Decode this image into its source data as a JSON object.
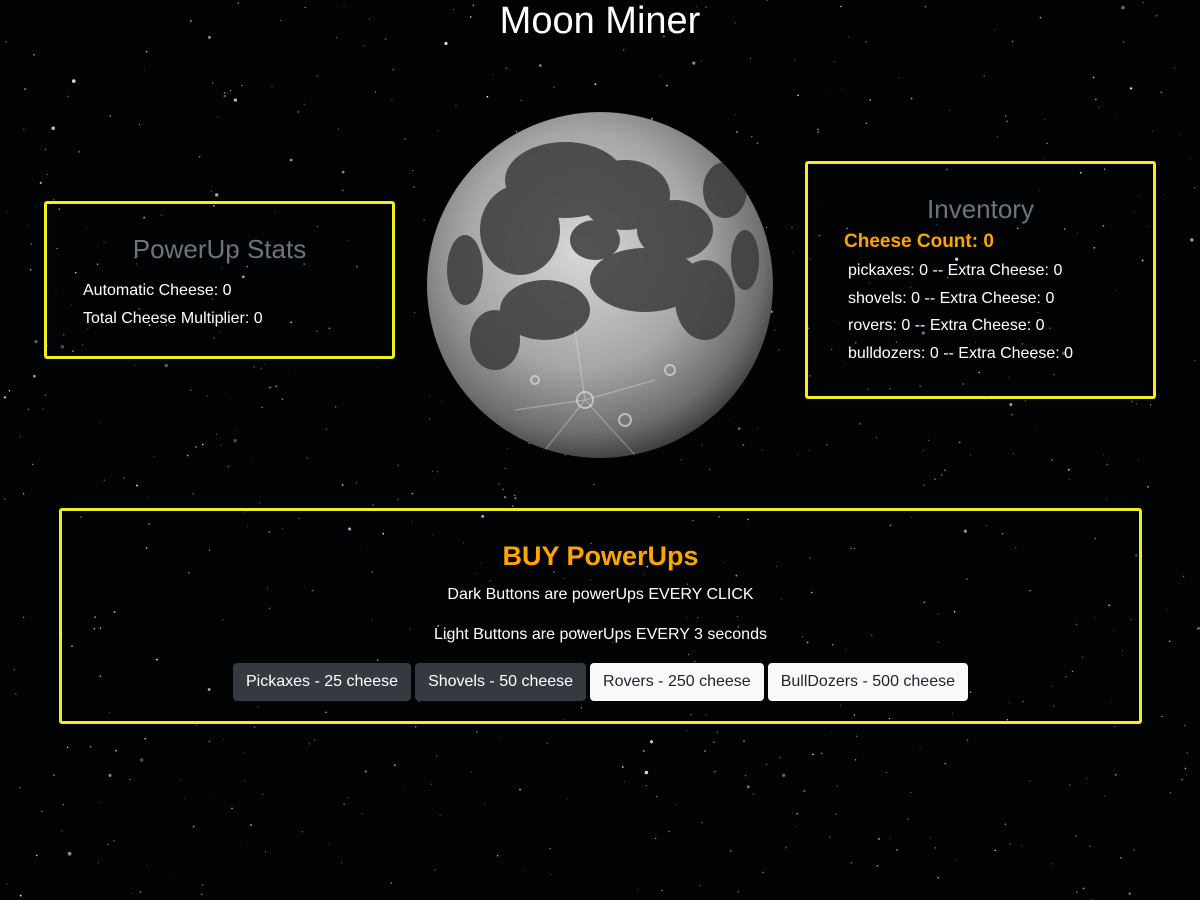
{
  "page": {
    "title": "Moon Miner"
  },
  "powerup_stats": {
    "heading": "PowerUp Stats",
    "automatic_cheese_label": "Automatic Cheese:",
    "automatic_cheese": "0",
    "total_multiplier_label": "Total Cheese Multiplier:",
    "total_multiplier": "0"
  },
  "inventory": {
    "heading": "Inventory",
    "cheese_count_label": "Cheese Count:",
    "cheese_count": "0",
    "extra_label": "-- Extra Cheese:",
    "items": [
      {
        "name": "pickaxes:",
        "count": "0",
        "extra": "0"
      },
      {
        "name": "shovels:",
        "count": "0",
        "extra": "0"
      },
      {
        "name": "rovers:",
        "count": "0",
        "extra": "0"
      },
      {
        "name": "bulldozers:",
        "count": "0",
        "extra": "0"
      }
    ]
  },
  "moon": {
    "icon": "moon-icon"
  },
  "buy": {
    "heading": "BUY PowerUps",
    "desc_dark": "Dark Buttons are powerUps EVERY CLICK",
    "desc_light": "Light Buttons are powerUps EVERY 3 seconds",
    "buttons": [
      {
        "label": "Pickaxes - 25 cheese",
        "style": "dark"
      },
      {
        "label": "Shovels - 50 cheese",
        "style": "dark"
      },
      {
        "label": "Rovers - 250 cheese",
        "style": "light"
      },
      {
        "label": "BullDozers - 500 cheese",
        "style": "light"
      }
    ]
  },
  "colors": {
    "background": "#020305",
    "panel_border": "#f6ee18",
    "accent_orange": "#ffa500",
    "heading_gray": "#6c757d",
    "text": "#ffffff"
  }
}
